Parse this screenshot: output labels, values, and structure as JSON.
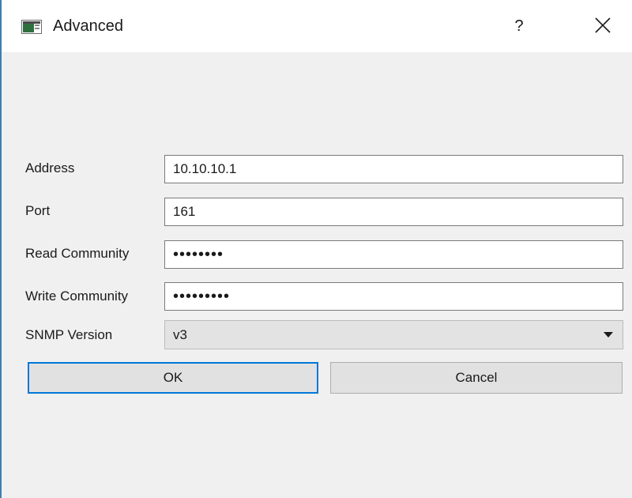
{
  "window": {
    "title": "Advanced"
  },
  "titlebar": {
    "help_label": "?",
    "close_icon": "close-icon"
  },
  "form": {
    "address": {
      "label": "Address",
      "value": "10.10.10.1"
    },
    "port": {
      "label": "Port",
      "value": "161"
    },
    "read_community": {
      "label": "Read Community",
      "masked_value": "••••••••"
    },
    "write_community": {
      "label": "Write Community",
      "masked_value": "•••••••••"
    },
    "snmp_version": {
      "label": "SNMP Version",
      "value": "v3"
    }
  },
  "buttons": {
    "ok": "OK",
    "cancel": "Cancel"
  },
  "colors": {
    "accent": "#0078d7",
    "window_bg": "#f0f0f0",
    "field_border": "#7a7a7a",
    "button_bg": "#e1e1e1"
  },
  "icons": [
    "app-window-icon",
    "help-icon",
    "close-icon",
    "dropdown-arrow-icon"
  ]
}
